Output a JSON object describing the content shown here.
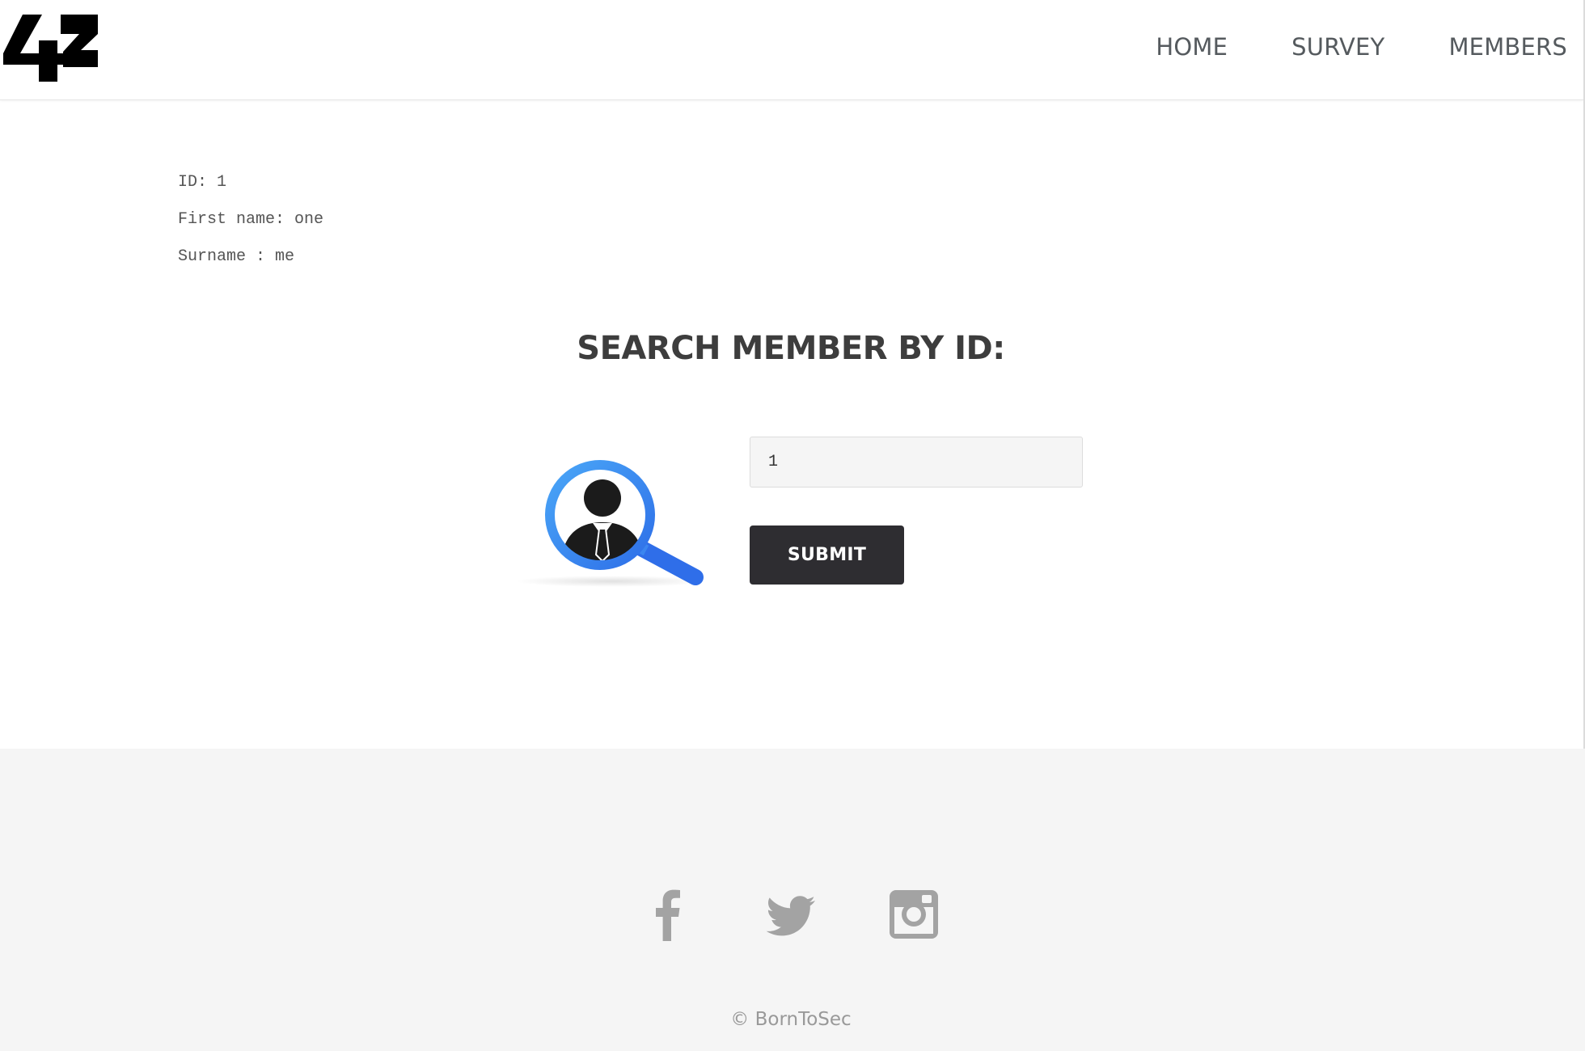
{
  "header": {
    "logo_text": "42",
    "nav": [
      {
        "label": "HOME"
      },
      {
        "label": "SURVEY"
      },
      {
        "label": "MEMBERS"
      }
    ]
  },
  "member": {
    "id_line": "ID: 1",
    "first_name_line": "First name: one",
    "surname_line": "Surname : me"
  },
  "search": {
    "title": "SEARCH MEMBER BY ID:",
    "input_value": "1",
    "submit_label": "SUBMIT",
    "illustration": "member-search-magnifier"
  },
  "footer": {
    "social": [
      {
        "icon": "facebook-icon"
      },
      {
        "icon": "twitter-icon"
      },
      {
        "icon": "instagram-icon"
      }
    ],
    "copyright": "© BornToSec"
  },
  "colors": {
    "nav_text": "#555a5e",
    "button_bg": "#2e2d31",
    "footer_bg": "#f5f5f5",
    "social_icon": "#a3a3a3",
    "magnifier_blue": "#3b8df0"
  }
}
